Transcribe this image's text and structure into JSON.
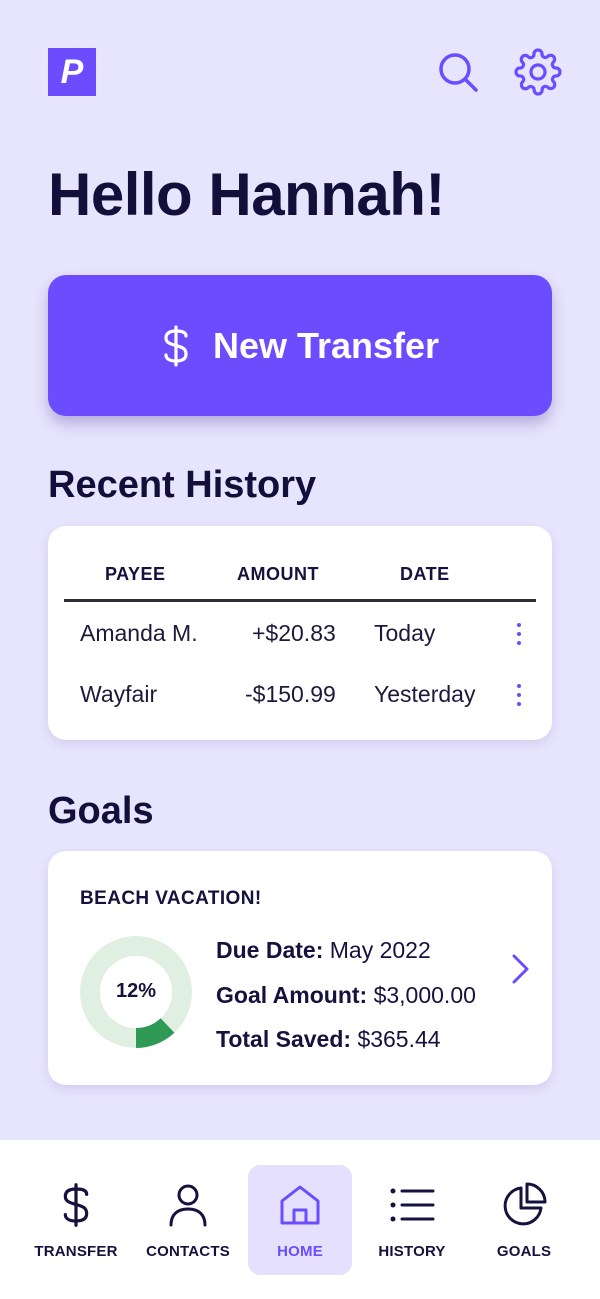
{
  "app": {
    "logo_letter": "P",
    "brand_color": "#6b4cff",
    "background": "#e7e4fd"
  },
  "header": {
    "greeting": "Hello Hannah!",
    "search_icon": "search-icon",
    "settings_icon": "gear-icon"
  },
  "transfer_button": {
    "label": "New Transfer",
    "icon": "dollar-icon"
  },
  "recent_history": {
    "title": "Recent History",
    "columns": [
      "PAYEE",
      "AMOUNT",
      "DATE"
    ],
    "rows": [
      {
        "payee": "Amanda M.",
        "amount": "+$20.83",
        "date": "Today"
      },
      {
        "payee": "Wayfair",
        "amount": "-$150.99",
        "date": "Yesterday"
      }
    ]
  },
  "goals": {
    "title": "Goals",
    "card": {
      "name": "BEACH VACATION!",
      "progress_label": "12%",
      "progress": 0.12,
      "ring_color": "#dff0e3",
      "fill_color": "#2f9a55",
      "due_date_label": "Due Date:",
      "due_date_value": "May 2022",
      "goal_amount_label": "Goal Amount:",
      "goal_amount_value": "$3,000.00",
      "total_saved_label": "Total Saved:",
      "total_saved_value": "$365.44"
    }
  },
  "bottom_nav": {
    "items": [
      {
        "label": "TRANSFER",
        "icon": "dollar-icon"
      },
      {
        "label": "CONTACTS",
        "icon": "person-icon"
      },
      {
        "label": "HOME",
        "icon": "home-icon",
        "active": true
      },
      {
        "label": "HISTORY",
        "icon": "list-icon"
      },
      {
        "label": "GOALS",
        "icon": "pie-chart-icon"
      }
    ]
  }
}
